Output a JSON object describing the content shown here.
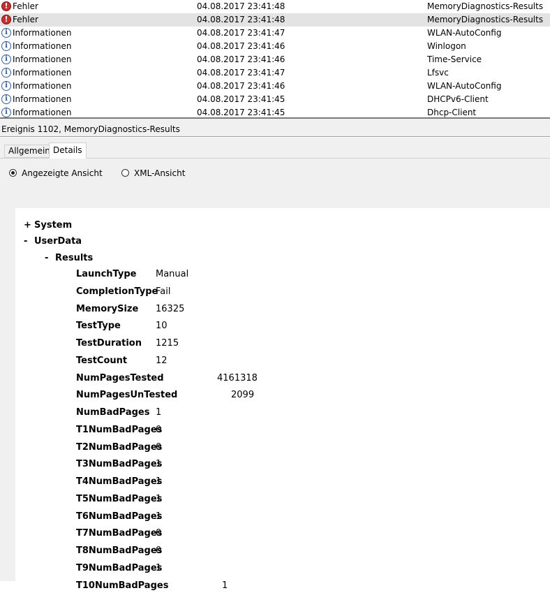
{
  "events": [
    {
      "level": "Fehler",
      "level_icon": "error-icon",
      "date": "04.08.2017 23:41:48",
      "source": "MemoryDiagnostics-Results",
      "selected": false
    },
    {
      "level": "Fehler",
      "level_icon": "error-icon",
      "date": "04.08.2017 23:41:48",
      "source": "MemoryDiagnostics-Results",
      "selected": true
    },
    {
      "level": "Informationen",
      "level_icon": "info-icon",
      "date": "04.08.2017 23:41:47",
      "source": "WLAN-AutoConfig",
      "selected": false
    },
    {
      "level": "Informationen",
      "level_icon": "info-icon",
      "date": "04.08.2017 23:41:46",
      "source": "Winlogon",
      "selected": false
    },
    {
      "level": "Informationen",
      "level_icon": "info-icon",
      "date": "04.08.2017 23:41:46",
      "source": "Time-Service",
      "selected": false
    },
    {
      "level": "Informationen",
      "level_icon": "info-icon",
      "date": "04.08.2017 23:41:47",
      "source": "Lfsvc",
      "selected": false
    },
    {
      "level": "Informationen",
      "level_icon": "info-icon",
      "date": "04.08.2017 23:41:46",
      "source": "WLAN-AutoConfig",
      "selected": false
    },
    {
      "level": "Informationen",
      "level_icon": "info-icon",
      "date": "04.08.2017 23:41:45",
      "source": "DHCPv6-Client",
      "selected": false
    },
    {
      "level": "Informationen",
      "level_icon": "info-icon",
      "date": "04.08.2017 23:41:45",
      "source": "Dhcp-Client",
      "selected": false
    }
  ],
  "details": {
    "header": "Ereignis 1102, MemoryDiagnostics-Results",
    "tabs": [
      {
        "label": "Allgemein",
        "active": false
      },
      {
        "label": "Details",
        "active": true
      }
    ],
    "view_options": [
      {
        "label": "Angezeigte Ansicht",
        "selected": true
      },
      {
        "label": "XML-Ansicht",
        "selected": false
      }
    ],
    "tree": {
      "system": {
        "toggle": "+",
        "label": "System"
      },
      "userdata": {
        "toggle": "-",
        "label": "UserData"
      },
      "results": {
        "toggle": "-",
        "label": "Results"
      },
      "properties": [
        {
          "name": "LaunchType",
          "value": "Manual"
        },
        {
          "name": "CompletionType",
          "value": "Fail"
        },
        {
          "name": "MemorySize",
          "value": "16325"
        },
        {
          "name": "TestType",
          "value": "10"
        },
        {
          "name": "TestDuration",
          "value": "1215"
        },
        {
          "name": "TestCount",
          "value": "12"
        },
        {
          "name": "NumPagesTested",
          "value": "4161318"
        },
        {
          "name": "NumPagesUnTested",
          "value": "2099"
        },
        {
          "name": "NumBadPages",
          "value": "1"
        },
        {
          "name": "T1NumBadPages",
          "value": "0"
        },
        {
          "name": "T2NumBadPages",
          "value": "0"
        },
        {
          "name": "T3NumBadPages",
          "value": "1"
        },
        {
          "name": "T4NumBadPages",
          "value": "1"
        },
        {
          "name": "T5NumBadPages",
          "value": "1"
        },
        {
          "name": "T6NumBadPages",
          "value": "1"
        },
        {
          "name": "T7NumBadPages",
          "value": "0"
        },
        {
          "name": "T8NumBadPages",
          "value": "0"
        },
        {
          "name": "T9NumBadPages",
          "value": "1"
        },
        {
          "name": "T10NumBadPages",
          "value": "1"
        }
      ]
    }
  },
  "colors": {
    "error": "#c9302c",
    "info": "#2a5ea8",
    "selected_row": "#e3e3e3"
  }
}
